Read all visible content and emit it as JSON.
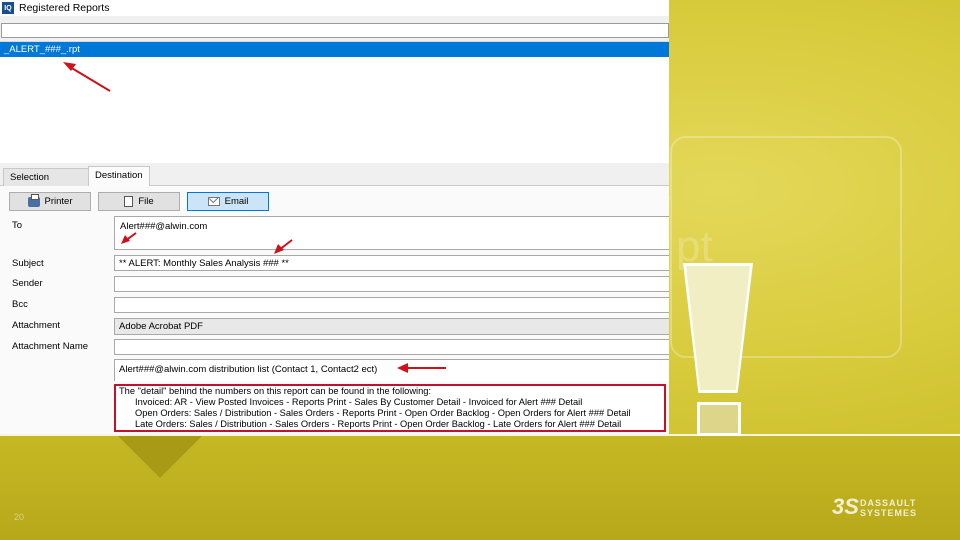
{
  "window": {
    "title": "Registered Reports",
    "app_icon_text": "IQ"
  },
  "report_list": {
    "filter_value": "",
    "selected_item": "_ALERT_###_.rpt"
  },
  "tabs": [
    {
      "label": "Selection Criteria"
    },
    {
      "label": "Destination"
    }
  ],
  "destination": {
    "buttons": {
      "printer": "Printer",
      "file": "File",
      "email": "Email"
    },
    "selected_button": "email",
    "fields": {
      "to": {
        "label": "To",
        "value": "Alert###@alwin.com"
      },
      "subject": {
        "label": "Subject",
        "value": "** ALERT:  Monthly Sales Analysis ### **"
      },
      "sender": {
        "label": "Sender",
        "value": ""
      },
      "bcc": {
        "label": "Bcc",
        "value": ""
      },
      "attachment": {
        "label": "Attachment",
        "value": "Adobe Acrobat PDF"
      },
      "attachment_name": {
        "label": "Attachment Name",
        "value": ""
      }
    },
    "body": {
      "line1": "Alert###@alwin.com distribution list (Contact 1, Contact2 ect)",
      "detail_intro": "The \"detail\" behind the numbers on this report can be found in the following:",
      "detail_lines": [
        "Invoiced: AR - View Posted Invoices - Reports Print - Sales By Customer Detail - Invoiced for Alert ### Detail",
        "Open Orders: Sales / Distribution - Sales Orders - Reports Print - Open Order Backlog - Open Orders for Alert ### Detail",
        "Late Orders: Sales / Distribution - Sales Orders - Reports Print - Open Order Backlog - Late Orders for Alert ### Detail"
      ]
    }
  },
  "slide": {
    "page_number": "20",
    "logo_line1": "DASSAULT",
    "logo_line2": "SYSTEMES",
    "colors": {
      "background": "#d8cb3c",
      "selection": "#0078d7",
      "highlight_box": "#c4102f",
      "arrows": "#d0101a"
    }
  }
}
